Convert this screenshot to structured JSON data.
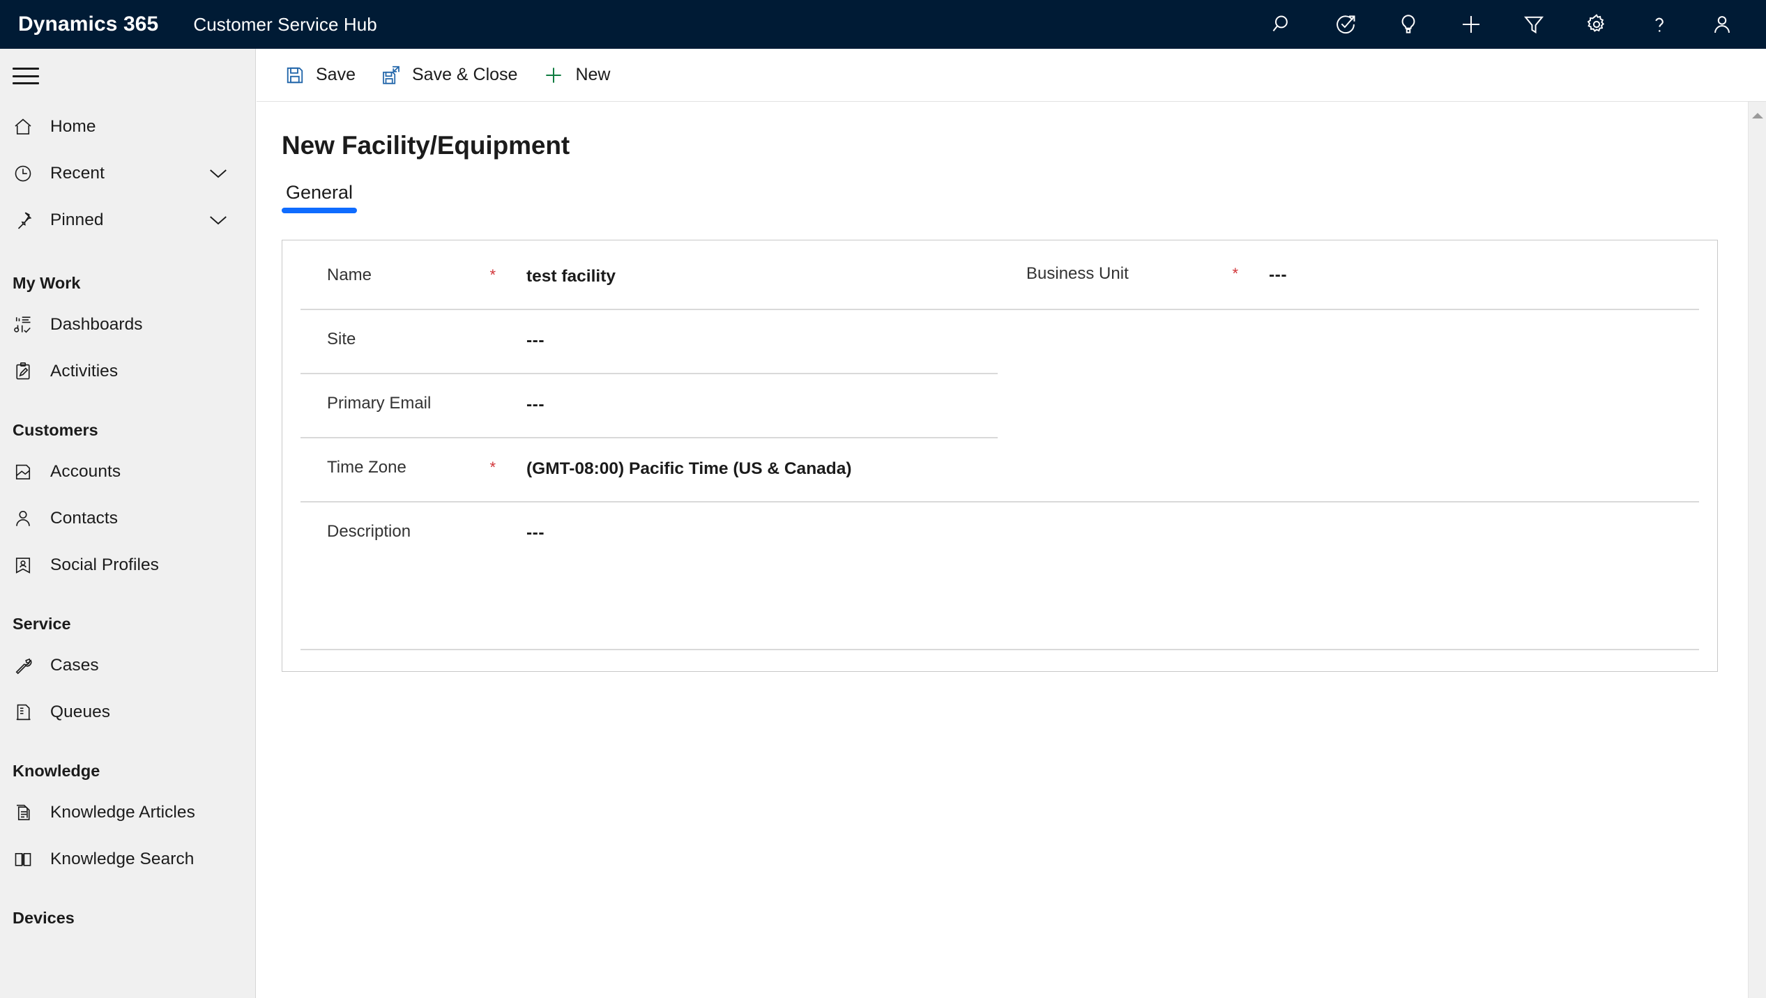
{
  "topbar": {
    "brand": "Dynamics 365",
    "app_name": "Customer Service Hub",
    "bg_color": "#001b35",
    "icons": [
      {
        "name": "search-icon",
        "label": "Search"
      },
      {
        "name": "focused-view-icon",
        "label": "Focused view"
      },
      {
        "name": "lightbulb-icon",
        "label": "Insights"
      },
      {
        "name": "plus-icon",
        "label": "Quick create"
      },
      {
        "name": "filter-icon",
        "label": "Filter"
      },
      {
        "name": "gear-icon",
        "label": "Settings"
      },
      {
        "name": "help-icon",
        "label": "Help"
      },
      {
        "name": "user-icon",
        "label": "Account manager"
      }
    ]
  },
  "sidebar": {
    "hamburger_label": "Site map",
    "items": [
      {
        "label": "Home",
        "icon": "home-icon",
        "chevron": false
      },
      {
        "label": "Recent",
        "icon": "clock-icon",
        "chevron": true
      },
      {
        "label": "Pinned",
        "icon": "pin-icon",
        "chevron": true
      }
    ],
    "groups": [
      {
        "title": "My Work",
        "items": [
          {
            "label": "Dashboards",
            "icon": "dashboard-icon"
          },
          {
            "label": "Activities",
            "icon": "activities-icon"
          }
        ]
      },
      {
        "title": "Customers",
        "items": [
          {
            "label": "Accounts",
            "icon": "accounts-icon"
          },
          {
            "label": "Contacts",
            "icon": "contact-icon"
          },
          {
            "label": "Social Profiles",
            "icon": "social-profile-icon"
          }
        ]
      },
      {
        "title": "Service",
        "items": [
          {
            "label": "Cases",
            "icon": "wrench-icon"
          },
          {
            "label": "Queues",
            "icon": "queue-icon"
          }
        ]
      },
      {
        "title": "Knowledge",
        "items": [
          {
            "label": "Knowledge Articles",
            "icon": "article-icon"
          },
          {
            "label": "Knowledge Search",
            "icon": "book-icon"
          }
        ]
      },
      {
        "title": "Devices",
        "items": []
      }
    ]
  },
  "command_bar": {
    "buttons": [
      {
        "label": "Save",
        "icon": "save-icon",
        "color": "#2266aa"
      },
      {
        "label": "Save & Close",
        "icon": "save-close-icon",
        "color": "#2266aa"
      },
      {
        "label": "New",
        "icon": "plus-icon",
        "color": "#107c41"
      }
    ]
  },
  "main": {
    "title": "New Facility/Equipment",
    "tabs": [
      {
        "label": "General",
        "active": true
      }
    ],
    "accent_color": "#0f6cff",
    "required_color": "#d13438",
    "form": {
      "left_fields": [
        {
          "label": "Name",
          "required": true,
          "value": "test facility",
          "separator": "full"
        },
        {
          "label": "Site",
          "required": false,
          "value": "---",
          "separator": "half"
        },
        {
          "label": "Primary Email",
          "required": false,
          "value": "---",
          "separator": "half"
        },
        {
          "label": "Time Zone",
          "required": true,
          "value": "(GMT-08:00) Pacific Time (US & Canada)",
          "separator": "full"
        },
        {
          "label": "Description",
          "required": false,
          "value": "---",
          "separator": "full"
        }
      ],
      "right_fields": [
        {
          "label": "Business Unit",
          "required": true,
          "value": "---"
        }
      ]
    }
  },
  "scrollbar": {
    "up_arrow": "scroll-up-arrow"
  }
}
